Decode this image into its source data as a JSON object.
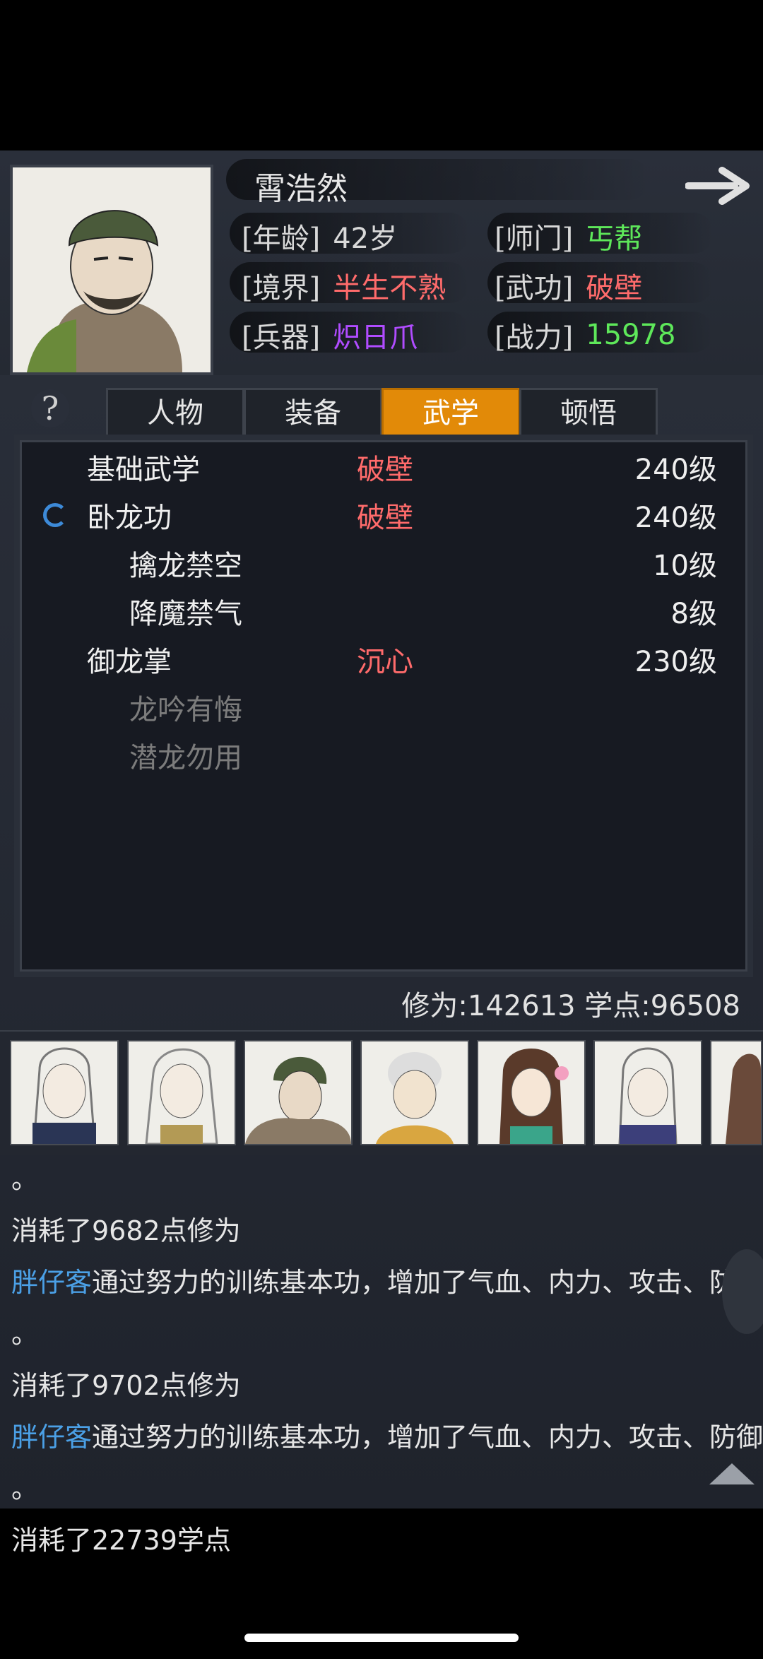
{
  "character": {
    "name": "霄浩然",
    "stats": [
      {
        "key": "[年龄]",
        "value": "42岁",
        "color": "white"
      },
      {
        "key": "[师门]",
        "value": "丐帮",
        "color": "green"
      },
      {
        "key": "[境界]",
        "value": "半生不熟",
        "color": "red"
      },
      {
        "key": "[武功]",
        "value": "破壁",
        "color": "red"
      },
      {
        "key": "[兵器]",
        "value": "炽日爪",
        "color": "purple"
      },
      {
        "key": "[战力]",
        "value": "15978",
        "color": "green"
      }
    ]
  },
  "help_label": "?",
  "tabs": [
    {
      "label": "人物",
      "active": false
    },
    {
      "label": "装备",
      "active": false
    },
    {
      "label": "武学",
      "active": true
    },
    {
      "label": "顿悟",
      "active": false
    }
  ],
  "skills": [
    {
      "name": "基础武学",
      "rank": "破壁",
      "level": "240级",
      "indent": 0,
      "dim": false,
      "loading": false
    },
    {
      "name": "卧龙功",
      "rank": "破壁",
      "level": "240级",
      "indent": 0,
      "dim": false,
      "loading": true
    },
    {
      "name": "擒龙禁空",
      "rank": "",
      "level": "10级",
      "indent": 1,
      "dim": false,
      "loading": false
    },
    {
      "name": "降魔禁气",
      "rank": "",
      "level": "8级",
      "indent": 1,
      "dim": false,
      "loading": false
    },
    {
      "name": "御龙掌",
      "rank": "沉心",
      "level": "230级",
      "indent": 0,
      "dim": false,
      "loading": false
    },
    {
      "name": "龙吟有悔",
      "rank": "",
      "level": "",
      "indent": 1,
      "dim": true,
      "loading": false
    },
    {
      "name": "潜龙勿用",
      "rank": "",
      "level": "",
      "indent": 1,
      "dim": true,
      "loading": false
    }
  ],
  "points": {
    "text": "修为:142613  学点:96508"
  },
  "log": [
    {
      "who": "",
      "text": "。"
    },
    {
      "who": "",
      "text": "消耗了9682点修为"
    },
    {
      "who": "胖仔客",
      "text": "通过努力的训练基本功，增加了气血、内力、攻击、防御"
    },
    {
      "who": "",
      "text": "。"
    },
    {
      "who": "",
      "text": "消耗了9702点修为"
    },
    {
      "who": "胖仔客",
      "text": "通过努力的训练基本功，增加了气血、内力、攻击、防御"
    },
    {
      "who": "",
      "text": "。"
    },
    {
      "who": "",
      "text": "消耗了22739学点"
    }
  ]
}
